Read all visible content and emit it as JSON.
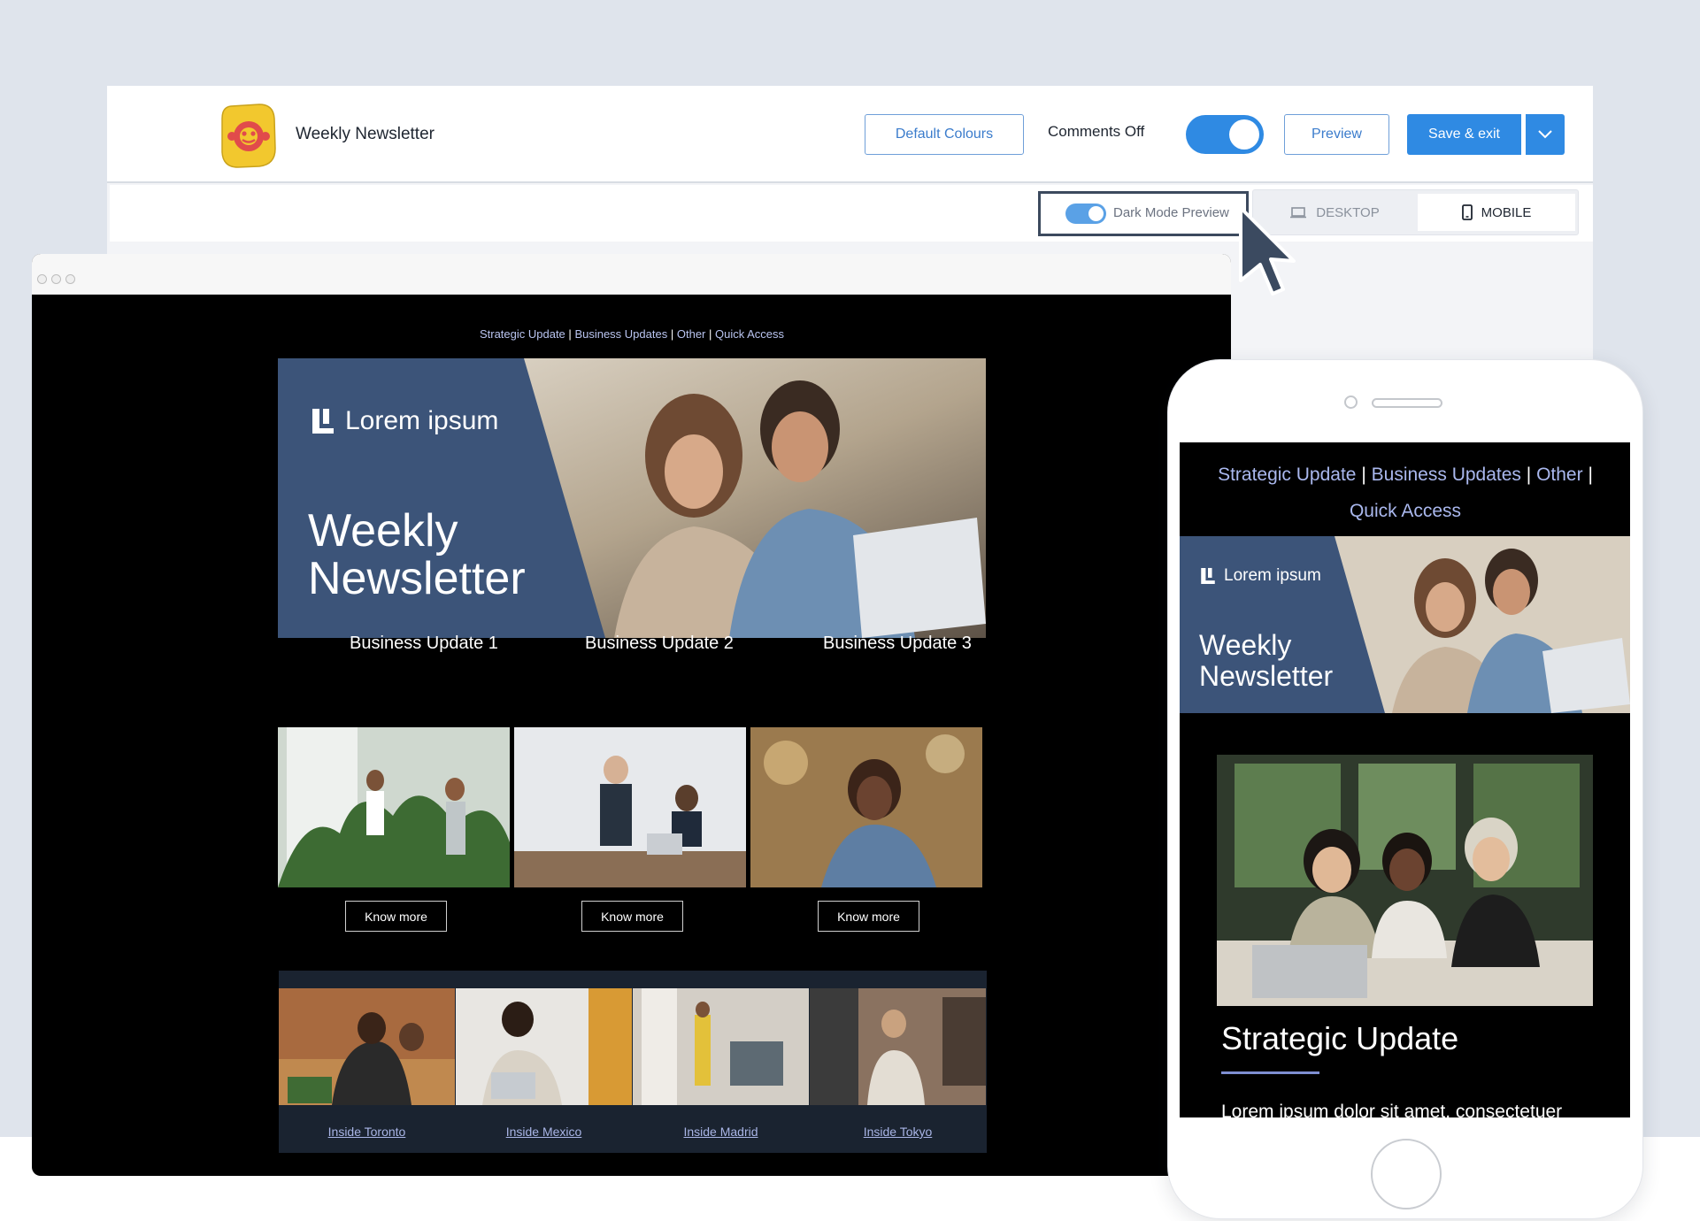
{
  "app": {
    "title": "Weekly Newsletter",
    "default_colours_label": "Default Colours",
    "comments_label": "Comments Off",
    "comments_toggle_on": true,
    "preview_label": "Preview",
    "save_label": "Save & exit",
    "dark_mode_label": "Dark Mode Preview",
    "dark_mode_on": true,
    "device_desktop_label": "DESKTOP",
    "device_mobile_label": "MOBILE",
    "selected_device": "MOBILE",
    "accent_color": "#2f8ae3"
  },
  "email": {
    "nav": {
      "links": [
        "Strategic Update",
        "Business Updates",
        "Other",
        "Quick Access"
      ],
      "separator": "|"
    },
    "hero": {
      "brand": "Lorem ipsum",
      "title_line1": "Weekly",
      "title_line2": "Newsletter",
      "banner_color": "#3c5479"
    },
    "business_updates": [
      {
        "title": "Business Update 1",
        "button": "Know more"
      },
      {
        "title": "Business Update 2",
        "button": "Know more"
      },
      {
        "title": "Business Update 3",
        "button": "Know more"
      }
    ],
    "locations": [
      {
        "label": "Inside Toronto"
      },
      {
        "label": "Inside Mexico"
      },
      {
        "label": "Inside Madrid"
      },
      {
        "label": "Inside Tokyo"
      }
    ]
  },
  "mobile": {
    "nav": {
      "links": [
        "Strategic Update",
        "Business Updates",
        "Other",
        "Quick Access"
      ],
      "separator": "|"
    },
    "hero": {
      "brand": "Lorem ipsum",
      "title_line1": "Weekly",
      "title_line2": "Newsletter"
    },
    "section_title": "Strategic Update",
    "body_text": "Lorem ipsum dolor sit amet, consectetuer"
  }
}
